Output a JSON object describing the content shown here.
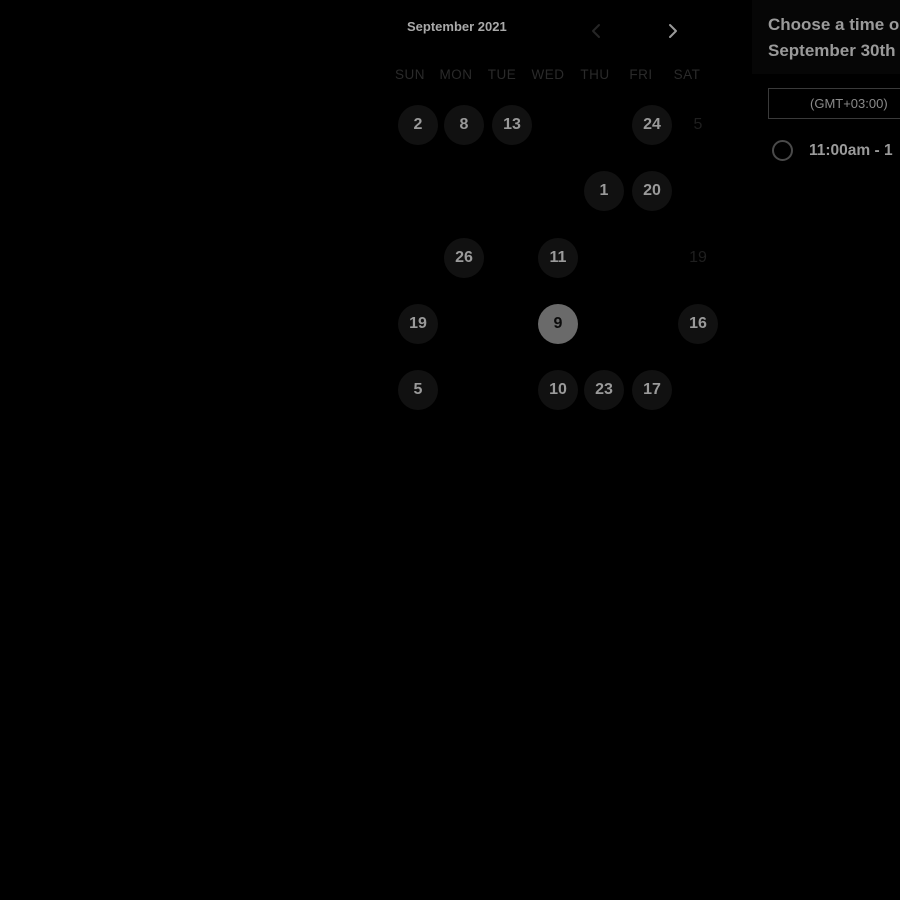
{
  "calendar": {
    "month_label": "September 2021",
    "weekdays": [
      "SUN",
      "MON",
      "TUE",
      "WED",
      "THU",
      "FRI",
      "SAT"
    ],
    "weeks": [
      [
        {
          "label": "2",
          "state": "available"
        },
        {
          "label": "8",
          "state": "available"
        },
        {
          "label": "13",
          "state": "available"
        },
        {
          "label": "",
          "state": "unavailable"
        },
        {
          "label": "",
          "state": "unavailable"
        },
        {
          "label": "24",
          "state": "available"
        },
        {
          "label": "5",
          "state": "unavailable"
        }
      ],
      [
        {
          "label": "",
          "state": "unavailable"
        },
        {
          "label": "",
          "state": "unavailable"
        },
        {
          "label": "",
          "state": "unavailable"
        },
        {
          "label": "",
          "state": "unavailable"
        },
        {
          "label": "1",
          "state": "available"
        },
        {
          "label": "20",
          "state": "available"
        },
        {
          "label": "",
          "state": "unavailable"
        }
      ],
      [
        {
          "label": "",
          "state": "unavailable"
        },
        {
          "label": "26",
          "state": "available"
        },
        {
          "label": "",
          "state": "unavailable"
        },
        {
          "label": "11",
          "state": "available"
        },
        {
          "label": "",
          "state": "unavailable"
        },
        {
          "label": "",
          "state": "unavailable"
        },
        {
          "label": "19",
          "state": "unavailable"
        }
      ],
      [
        {
          "label": "19",
          "state": "available"
        },
        {
          "label": "",
          "state": "unavailable"
        },
        {
          "label": "",
          "state": "unavailable"
        },
        {
          "label": "9",
          "state": "selected"
        },
        {
          "label": "",
          "state": "unavailable"
        },
        {
          "label": "",
          "state": "unavailable"
        },
        {
          "label": "16",
          "state": "available"
        }
      ],
      [
        {
          "label": "5",
          "state": "available"
        },
        {
          "label": "",
          "state": "unavailable"
        },
        {
          "label": "",
          "state": "unavailable"
        },
        {
          "label": "10",
          "state": "available"
        },
        {
          "label": "23",
          "state": "available"
        },
        {
          "label": "17",
          "state": "available"
        },
        {
          "label": "",
          "state": "unavailable"
        }
      ]
    ]
  },
  "time_panel": {
    "heading_line1": "Choose a time on",
    "heading_line2": "September 30th",
    "timezone": "(GMT+03:00)",
    "slots": [
      {
        "label": "11:00am - 1"
      }
    ]
  },
  "colors": {
    "background": "#000000",
    "available_day_bg": "#111111",
    "selected_day_bg": "#6a6a6a",
    "text_muted": "#9a9a9a"
  },
  "icons": {
    "prev": "chevron-left-icon",
    "next": "chevron-right-icon",
    "slot": "radio-circle-icon"
  }
}
